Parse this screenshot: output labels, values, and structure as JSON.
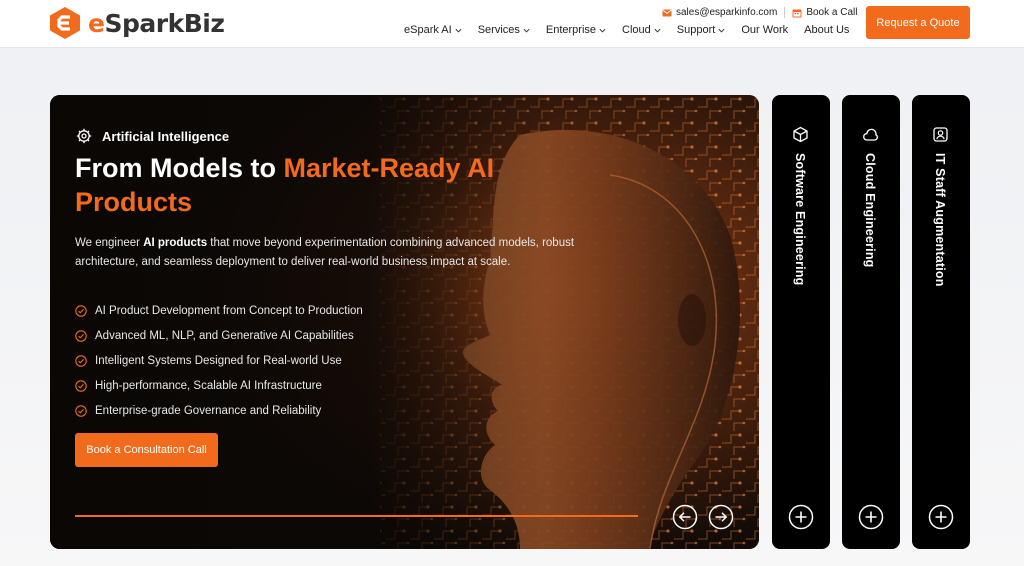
{
  "brand": {
    "logo_text_prefix": "e",
    "logo_text_rest": "SparkBiz",
    "accent": "#f26b1d"
  },
  "contact": {
    "email": "sales@esparkinfo.com",
    "email_icon": "mail-icon",
    "call_label": "Book a Call",
    "call_icon": "calendar-icon"
  },
  "nav": {
    "items": [
      {
        "label": "eSpark AI",
        "has_dropdown": true
      },
      {
        "label": "Services",
        "has_dropdown": true
      },
      {
        "label": "Enterprise",
        "has_dropdown": true
      },
      {
        "label": "Cloud",
        "has_dropdown": true
      },
      {
        "label": "Support",
        "has_dropdown": true
      },
      {
        "label": "Our Work",
        "has_dropdown": false
      },
      {
        "label": "About Us",
        "has_dropdown": false
      }
    ],
    "quote_button": "Request a Quote"
  },
  "hero": {
    "category": "Artificial Intelligence",
    "category_icon": "gear-icon",
    "headline_plain": "From Models to ",
    "headline_highlight": "Market-Ready AI Products",
    "desc_before": "We engineer ",
    "desc_bold": "AI products",
    "desc_after": " that move beyond experimentation combining advanced models, robust architecture, and seamless deployment to deliver real-world business impact at scale.",
    "features": [
      "AI Product Development from Concept to Production",
      "Advanced ML, NLP, and Generative AI Capabilities",
      "Intelligent Systems Designed for Real-world Use",
      "High-performance, Scalable AI Infrastructure",
      "Enterprise-grade Governance and Reliability"
    ],
    "cta": "Book a Consultation Call",
    "prev_icon": "arrow-left-icon",
    "next_icon": "arrow-right-icon"
  },
  "tabs": [
    {
      "label": "Software Engineering",
      "icon": "cube-icon"
    },
    {
      "label": "Cloud Engineering",
      "icon": "cloud-icon"
    },
    {
      "label": "IT Staff Augmentation",
      "icon": "person-icon"
    }
  ]
}
